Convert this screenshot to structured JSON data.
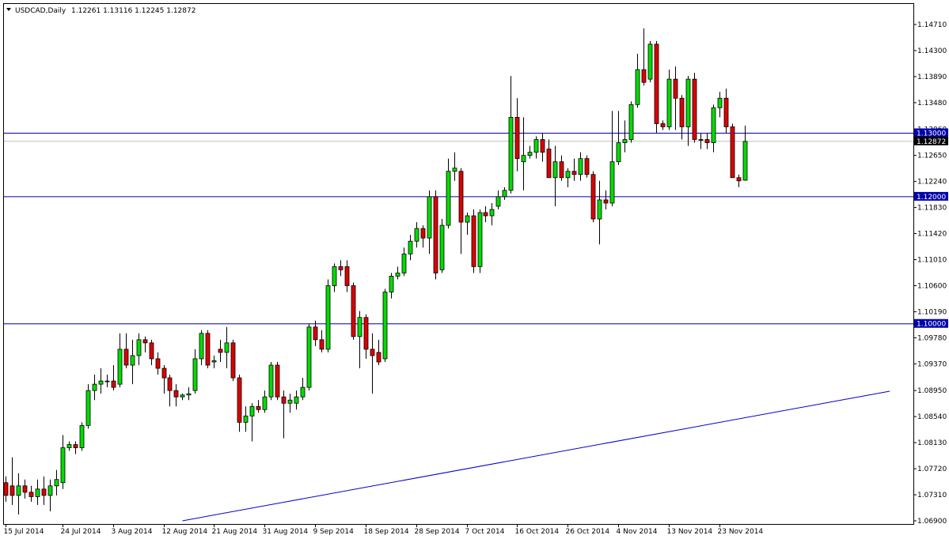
{
  "header": {
    "symbol": "USDCAD,Daily",
    "ohlc": "1.12261 1.13116 1.12245 1.12872"
  },
  "colors": {
    "background": "#ffffff",
    "axis": "#000000",
    "bull": "#00dd00",
    "bear": "#dd0000",
    "wick": "#000000",
    "level_line": "#0000aa",
    "price_line": "#c0c0c0",
    "trendline": "#0000cc",
    "price_tag": "#000000"
  },
  "chart_data": {
    "type": "candlestick",
    "symbol": "USDCAD",
    "timeframe": "Daily",
    "grid": false,
    "ylim": [
      1.069,
      1.149
    ],
    "y_ticks": [
      "1.14710",
      "1.14300",
      "1.13890",
      "1.13480",
      "1.13060",
      "1.12650",
      "1.12240",
      "1.11830",
      "1.11420",
      "1.11010",
      "1.10600",
      "1.10190",
      "1.09780",
      "1.09370",
      "1.08950",
      "1.08540",
      "1.08130",
      "1.07720",
      "1.07310",
      "1.06900"
    ],
    "x_ticks": [
      {
        "label": "15 Jul 2014",
        "index": 0
      },
      {
        "label": "24 Jul 2014",
        "index": 9
      },
      {
        "label": "3 Aug 2014",
        "index": 17
      },
      {
        "label": "12 Aug 2014",
        "index": 25
      },
      {
        "label": "21 Aug 2014",
        "index": 33
      },
      {
        "label": "31 Aug 2014",
        "index": 41
      },
      {
        "label": "9 Sep 2014",
        "index": 49
      },
      {
        "label": "18 Sep 2014",
        "index": 57
      },
      {
        "label": "28 Sep 2014",
        "index": 65
      },
      {
        "label": "7 Oct 2014",
        "index": 73
      },
      {
        "label": "16 Oct 2014",
        "index": 81
      },
      {
        "label": "26 Oct 2014",
        "index": 89
      },
      {
        "label": "4 Nov 2014",
        "index": 97
      },
      {
        "label": "13 Nov 2014",
        "index": 105
      },
      {
        "label": "23 Nov 2014",
        "index": 113
      }
    ],
    "candles": [
      [
        1.075,
        1.076,
        1.072,
        1.073
      ],
      [
        1.0745,
        1.079,
        1.0715,
        1.073
      ],
      [
        1.073,
        1.0765,
        1.07,
        1.0745
      ],
      [
        1.0745,
        1.0755,
        1.0725,
        1.0735
      ],
      [
        1.0735,
        1.0745,
        1.072,
        1.0728
      ],
      [
        1.0728,
        1.0755,
        1.0715,
        1.074
      ],
      [
        1.074,
        1.076,
        1.0715,
        1.073
      ],
      [
        1.073,
        1.0755,
        1.0705,
        1.0745
      ],
      [
        1.0745,
        1.077,
        1.073,
        1.0755
      ],
      [
        1.075,
        1.0825,
        1.074,
        1.0805
      ],
      [
        1.0805,
        1.0815,
        1.08,
        1.081
      ],
      [
        1.081,
        1.0815,
        1.0795,
        1.0805
      ],
      [
        1.0805,
        1.0845,
        1.08,
        1.084
      ],
      [
        1.084,
        1.0905,
        1.0835,
        1.0895
      ],
      [
        1.0895,
        1.092,
        1.088,
        1.0905
      ],
      [
        1.0905,
        1.093,
        1.089,
        1.091
      ],
      [
        1.091,
        1.092,
        1.09,
        1.091
      ],
      [
        1.091,
        1.0935,
        1.0895,
        1.09
      ],
      [
        1.0905,
        1.0985,
        1.09,
        1.096
      ],
      [
        1.096,
        1.0985,
        1.093,
        1.0935
      ],
      [
        1.0935,
        1.0975,
        1.0905,
        1.095
      ],
      [
        1.095,
        1.0985,
        1.0935,
        1.0975
      ],
      [
        1.0975,
        1.098,
        1.0955,
        1.097
      ],
      [
        1.097,
        1.0975,
        1.0935,
        1.0945
      ],
      [
        1.0945,
        1.0955,
        1.092,
        1.093
      ],
      [
        1.093,
        1.0935,
        1.089,
        1.0915
      ],
      [
        1.0915,
        1.092,
        1.087,
        1.0895
      ],
      [
        1.0895,
        1.0905,
        1.087,
        1.0885
      ],
      [
        1.0885,
        1.089,
        1.088,
        1.0888
      ],
      [
        1.0888,
        1.09,
        1.088,
        1.089
      ],
      [
        1.0895,
        1.096,
        1.089,
        1.0945
      ],
      [
        1.0945,
        1.099,
        1.0935,
        1.0985
      ],
      [
        1.0985,
        1.099,
        1.093,
        1.0935
      ],
      [
        1.094,
        1.095,
        1.093,
        1.0942
      ],
      [
        1.096,
        1.0975,
        1.094,
        1.0955
      ],
      [
        1.0955,
        1.0995,
        1.093,
        1.097
      ],
      [
        1.097,
        1.0975,
        1.091,
        1.0915
      ],
      [
        1.0915,
        1.092,
        1.083,
        1.0845
      ],
      [
        1.0845,
        1.087,
        1.083,
        1.0855
      ],
      [
        1.0855,
        1.0875,
        1.0815,
        1.087
      ],
      [
        1.087,
        1.088,
        1.086,
        1.0865
      ],
      [
        1.0865,
        1.0895,
        1.086,
        1.0885
      ],
      [
        1.0885,
        1.094,
        1.088,
        1.0935
      ],
      [
        1.0935,
        1.094,
        1.088,
        1.0885
      ],
      [
        1.0885,
        1.0895,
        1.082,
        1.0875
      ],
      [
        1.0875,
        1.089,
        1.086,
        1.088
      ],
      [
        1.0875,
        1.0895,
        1.0865,
        1.0885
      ],
      [
        1.0885,
        1.0915,
        1.088,
        1.09
      ],
      [
        1.09,
        1.1,
        1.0895,
        1.0995
      ],
      [
        1.0995,
        1.1005,
        1.0965,
        1.0975
      ],
      [
        1.0975,
        1.099,
        1.0955,
        1.096
      ],
      [
        1.096,
        1.107,
        1.0955,
        1.106
      ],
      [
        1.106,
        1.1095,
        1.105,
        1.109
      ],
      [
        1.109,
        1.11,
        1.1075,
        1.1085
      ],
      [
        1.109,
        1.11,
        1.105,
        1.106
      ],
      [
        1.106,
        1.1065,
        1.0975,
        1.098
      ],
      [
        1.098,
        1.102,
        1.093,
        1.101
      ],
      [
        1.101,
        1.1015,
        1.0945,
        1.096
      ],
      [
        1.096,
        1.0985,
        1.089,
        1.095
      ],
      [
        1.0955,
        1.0975,
        1.0935,
        1.094
      ],
      [
        1.0945,
        1.1055,
        1.094,
        1.105
      ],
      [
        1.105,
        1.108,
        1.104,
        1.1075
      ],
      [
        1.1075,
        1.109,
        1.107,
        1.108
      ],
      [
        1.108,
        1.112,
        1.1075,
        1.111
      ],
      [
        1.111,
        1.114,
        1.11,
        1.113
      ],
      [
        1.113,
        1.116,
        1.112,
        1.115
      ],
      [
        1.115,
        1.1155,
        1.112,
        1.1135
      ],
      [
        1.1135,
        1.121,
        1.111,
        1.12
      ],
      [
        1.12,
        1.121,
        1.107,
        1.108
      ],
      [
        1.1085,
        1.1165,
        1.108,
        1.1155
      ],
      [
        1.1155,
        1.126,
        1.115,
        1.124
      ],
      [
        1.124,
        1.127,
        1.1225,
        1.1245
      ],
      [
        1.124,
        1.1245,
        1.111,
        1.116
      ],
      [
        1.116,
        1.1175,
        1.114,
        1.117
      ],
      [
        1.117,
        1.118,
        1.108,
        1.109
      ],
      [
        1.109,
        1.118,
        1.108,
        1.1175
      ],
      [
        1.1175,
        1.1185,
        1.116,
        1.117
      ],
      [
        1.117,
        1.119,
        1.1155,
        1.118
      ],
      [
        1.1185,
        1.121,
        1.118,
        1.12
      ],
      [
        1.12,
        1.1215,
        1.1195,
        1.121
      ],
      [
        1.121,
        1.139,
        1.1205,
        1.1325
      ],
      [
        1.1325,
        1.1355,
        1.124,
        1.126
      ],
      [
        1.1255,
        1.1325,
        1.121,
        1.1265
      ],
      [
        1.1265,
        1.128,
        1.126,
        1.127
      ],
      [
        1.127,
        1.1295,
        1.126,
        1.129
      ],
      [
        1.129,
        1.13,
        1.1255,
        1.127
      ],
      [
        1.1275,
        1.129,
        1.123,
        1.123
      ],
      [
        1.123,
        1.128,
        1.1185,
        1.1255
      ],
      [
        1.1255,
        1.1265,
        1.1225,
        1.123
      ],
      [
        1.123,
        1.1245,
        1.1215,
        1.124
      ],
      [
        1.124,
        1.126,
        1.1225,
        1.1235
      ],
      [
        1.1235,
        1.127,
        1.1225,
        1.126
      ],
      [
        1.126,
        1.1265,
        1.123,
        1.1235
      ],
      [
        1.1235,
        1.124,
        1.116,
        1.1165
      ],
      [
        1.1165,
        1.1225,
        1.1125,
        1.1195
      ],
      [
        1.1195,
        1.121,
        1.118,
        1.119
      ],
      [
        1.119,
        1.1335,
        1.1185,
        1.1255
      ],
      [
        1.1255,
        1.1335,
        1.125,
        1.1285
      ],
      [
        1.1285,
        1.132,
        1.127,
        1.129
      ],
      [
        1.129,
        1.135,
        1.1285,
        1.1345
      ],
      [
        1.1345,
        1.1425,
        1.134,
        1.14
      ],
      [
        1.14,
        1.1465,
        1.1375,
        1.138
      ],
      [
        1.1385,
        1.1445,
        1.138,
        1.144
      ],
      [
        1.144,
        1.1445,
        1.13,
        1.1315
      ],
      [
        1.1315,
        1.132,
        1.1305,
        1.131
      ],
      [
        1.131,
        1.14,
        1.1305,
        1.1385
      ],
      [
        1.1385,
        1.1405,
        1.1305,
        1.1355
      ],
      [
        1.1355,
        1.136,
        1.129,
        1.131
      ],
      [
        1.131,
        1.139,
        1.128,
        1.1385
      ],
      [
        1.1385,
        1.1395,
        1.1285,
        1.129
      ],
      [
        1.129,
        1.13,
        1.1275,
        1.129
      ],
      [
        1.129,
        1.13,
        1.1275,
        1.1285
      ],
      [
        1.1285,
        1.1345,
        1.127,
        1.134
      ],
      [
        1.134,
        1.1365,
        1.1325,
        1.1355
      ],
      [
        1.1355,
        1.137,
        1.13,
        1.131
      ],
      [
        1.131,
        1.1315,
        1.123,
        1.123
      ],
      [
        1.123,
        1.1235,
        1.1215,
        1.1225
      ],
      [
        1.1226,
        1.1312,
        1.1225,
        1.1287
      ]
    ],
    "horizontal_lines": [
      {
        "price": 1.13,
        "label": "1.13000"
      },
      {
        "price": 1.12,
        "label": "1.12000"
      },
      {
        "price": 1.1,
        "label": "1.10000"
      }
    ],
    "current_price": {
      "price": 1.12872,
      "label": "1.12872"
    },
    "trendline": {
      "from": {
        "index": 28,
        "price": 1.069
      },
      "to": {
        "index": 140,
        "price": 1.0894
      }
    }
  }
}
